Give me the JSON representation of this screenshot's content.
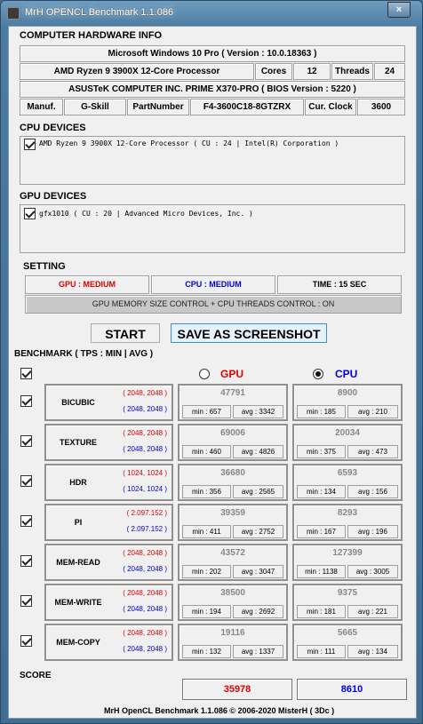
{
  "window": {
    "title": "MrH OPENCL Benchmark 1.1.086",
    "close_glyph": "×"
  },
  "hardware": {
    "heading": "COMPUTER HARDWARE INFO",
    "os": "Microsoft Windows 10 Pro ( Version : 10.0.18363 )",
    "cpu": "AMD Ryzen 9 3900X 12-Core Processor",
    "cores_label": "Cores",
    "cores": "12",
    "threads_label": "Threads",
    "threads": "24",
    "board": "ASUSTeK COMPUTER INC. PRIME X370-PRO ( BIOS Version : 5220 )",
    "manuf_label": "Manuf.",
    "manuf": "G-Skill",
    "part_label": "PartNumber",
    "part": "F4-3600C18-8GTZRX",
    "clock_label": "Cur. Clock",
    "clock": "3600"
  },
  "cpu_devices": {
    "heading": "CPU DEVICES",
    "items": [
      {
        "text": "AMD Ryzen 9 3900X 12-Core Processor        ( CU : 24 | Intel(R) Corporation )",
        "checked": true
      }
    ]
  },
  "gpu_devices": {
    "heading": "GPU DEVICES",
    "items": [
      {
        "text": "gfx1010 ( CU : 20 | Advanced Micro Devices, Inc. )",
        "checked": true
      }
    ]
  },
  "setting": {
    "heading": "SETTING",
    "gpu": "GPU : MEDIUM",
    "cpu": "CPU : MEDIUM",
    "time": "TIME : 15 SEC",
    "control": "GPU MEMORY SIZE CONTROL + CPU THREADS CONTROL : ON",
    "colors": {
      "gpu": "#e00000",
      "cpu": "#0000dd"
    }
  },
  "buttons": {
    "start": "START",
    "screenshot": "SAVE AS SCREENSHOT"
  },
  "benchmark": {
    "heading": "BENCHMARK ( TPS : MIN | AVG )",
    "gpu_label": "GPU",
    "cpu_label": "CPU",
    "selected": "CPU",
    "rows": [
      {
        "name": "BICUBIC",
        "gpu_dim": "( 2048, 2048 )",
        "cpu_dim": "( 2048, 2048 )",
        "gpu_val": "47791",
        "gpu_min": "min : 657",
        "gpu_avg": "avg : 3342",
        "cpu_val": "8900",
        "cpu_min": "min : 185",
        "cpu_avg": "avg : 210"
      },
      {
        "name": "TEXTURE",
        "gpu_dim": "( 2048, 2048 )",
        "cpu_dim": "( 2048, 2048 )",
        "gpu_val": "69006",
        "gpu_min": "min : 460",
        "gpu_avg": "avg : 4826",
        "cpu_val": "20034",
        "cpu_min": "min : 375",
        "cpu_avg": "avg : 473"
      },
      {
        "name": "HDR",
        "gpu_dim": "( 1024, 1024 )",
        "cpu_dim": "( 1024, 1024 )",
        "gpu_val": "36680",
        "gpu_min": "min : 356",
        "gpu_avg": "avg : 2565",
        "cpu_val": "6593",
        "cpu_min": "min : 134",
        "cpu_avg": "avg : 156"
      },
      {
        "name": "PI",
        "gpu_dim": "( 2.097.152 )",
        "cpu_dim": "( 2.097.152 )",
        "gpu_val": "39359",
        "gpu_min": "min : 411",
        "gpu_avg": "avg : 2752",
        "cpu_val": "8293",
        "cpu_min": "min : 167",
        "cpu_avg": "avg : 196"
      },
      {
        "name": "MEM-READ",
        "gpu_dim": "( 2048, 2048 )",
        "cpu_dim": "( 2048, 2048 )",
        "gpu_val": "43572",
        "gpu_min": "min : 202",
        "gpu_avg": "avg : 3047",
        "cpu_val": "127399",
        "cpu_min": "min : 1138",
        "cpu_avg": "avg : 3005"
      },
      {
        "name": "MEM-WRITE",
        "gpu_dim": "( 2048, 2048 )",
        "cpu_dim": "( 2048, 2048 )",
        "gpu_val": "38500",
        "gpu_min": "min : 194",
        "gpu_avg": "avg : 2692",
        "cpu_val": "9375",
        "cpu_min": "min : 181",
        "cpu_avg": "avg : 221"
      },
      {
        "name": "MEM-COPY",
        "gpu_dim": "( 2048, 2048 )",
        "cpu_dim": "( 2048, 2048 )",
        "gpu_val": "19116",
        "gpu_min": "min : 132",
        "gpu_avg": "avg : 1337",
        "cpu_val": "5665",
        "cpu_min": "min : 111",
        "cpu_avg": "avg : 134"
      }
    ]
  },
  "score": {
    "heading": "SCORE",
    "gpu": "35978",
    "cpu": "8610"
  },
  "footer": "MrH OpenCL Benchmark 1.1.086  ©  2006-2020 MisterH ( 3Dc )"
}
